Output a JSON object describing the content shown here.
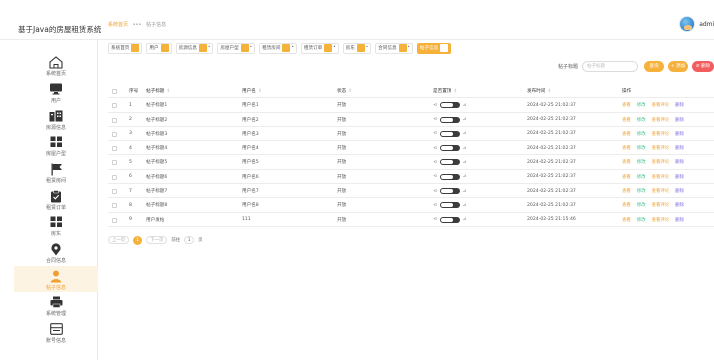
{
  "app": {
    "title": "基于Java的房屋租赁系统"
  },
  "breadcrumb": {
    "home": "系统首页",
    "separator": "•••",
    "current": "帖子信息"
  },
  "user": {
    "name": "admin"
  },
  "sidebar": {
    "items": [
      {
        "label": "系统首页",
        "icon": "home-icon"
      },
      {
        "label": "用户",
        "icon": "monitor-icon"
      },
      {
        "label": "房源信息",
        "icon": "building-icon"
      },
      {
        "label": "房屋户型",
        "icon": "grid-icon"
      },
      {
        "label": "租赁房间",
        "icon": "flag-icon"
      },
      {
        "label": "租赁订单",
        "icon": "clipboard-icon"
      },
      {
        "label": "房东",
        "icon": "grid-icon"
      },
      {
        "label": "合同信息",
        "icon": "map-pin-icon"
      },
      {
        "label": "帖子信息",
        "icon": "user-icon",
        "active": true
      },
      {
        "label": "系统管理",
        "icon": "print-icon"
      },
      {
        "label": "账号信息",
        "icon": "window-icon"
      }
    ]
  },
  "tabs": [
    {
      "label": "系统首页"
    },
    {
      "label": "用户"
    },
    {
      "label": "房源信息"
    },
    {
      "label": "房屋户型"
    },
    {
      "label": "租赁房间"
    },
    {
      "label": "租赁订单"
    },
    {
      "label": "房东"
    },
    {
      "label": "合同信息"
    },
    {
      "label": "帖子信息",
      "active": true
    }
  ],
  "search": {
    "label": "帖子标题",
    "placeholder": "帖子标题",
    "search_btn": "查询",
    "add_btn": "+ 添加",
    "delete_btn": "⊘ 删除"
  },
  "table": {
    "headers": {
      "index": "序号",
      "title": "帖子标题",
      "user": "用户名",
      "state": "状态",
      "top": "是否置顶",
      "time": "发布时间",
      "ops": "操作"
    },
    "ops": {
      "view": "查看",
      "edit": "修改",
      "comment": "查看评论",
      "delete": "删除"
    },
    "rows": [
      {
        "idx": "1",
        "title": "帖子标题1",
        "user": "用户名1",
        "state": "开放",
        "time": "2024-02-25 21:02:37"
      },
      {
        "idx": "2",
        "title": "帖子标题2",
        "user": "用户名2",
        "state": "开放",
        "time": "2024-02-25 21:02:37"
      },
      {
        "idx": "3",
        "title": "帖子标题3",
        "user": "用户名3",
        "state": "开放",
        "time": "2024-02-25 21:02:37"
      },
      {
        "idx": "4",
        "title": "帖子标题4",
        "user": "用户名4",
        "state": "开放",
        "time": "2024-02-25 21:02:37"
      },
      {
        "idx": "5",
        "title": "帖子标题5",
        "user": "用户名5",
        "state": "开放",
        "time": "2024-02-25 21:02:37"
      },
      {
        "idx": "6",
        "title": "帖子标题6",
        "user": "用户名6",
        "state": "开放",
        "time": "2024-02-25 21:02:37"
      },
      {
        "idx": "7",
        "title": "帖子标题7",
        "user": "用户名7",
        "state": "开放",
        "time": "2024-02-25 21:02:37"
      },
      {
        "idx": "8",
        "title": "帖子标题8",
        "user": "用户名8",
        "state": "开放",
        "time": "2024-02-25 21:02:37"
      },
      {
        "idx": "9",
        "title": "用户发帖",
        "user": "111",
        "state": "开放",
        "time": "2024-02-25 21:15:46"
      }
    ]
  },
  "pagination": {
    "prev": "上一页",
    "current": "1",
    "next": "下一页",
    "goto_prefix": "前往",
    "goto_value": "1",
    "goto_suffix": "页"
  },
  "colors": {
    "accent": "#f6b13a",
    "danger": "#f25d5d",
    "edit": "#3fbf8f",
    "delete": "#7e6ce0"
  }
}
